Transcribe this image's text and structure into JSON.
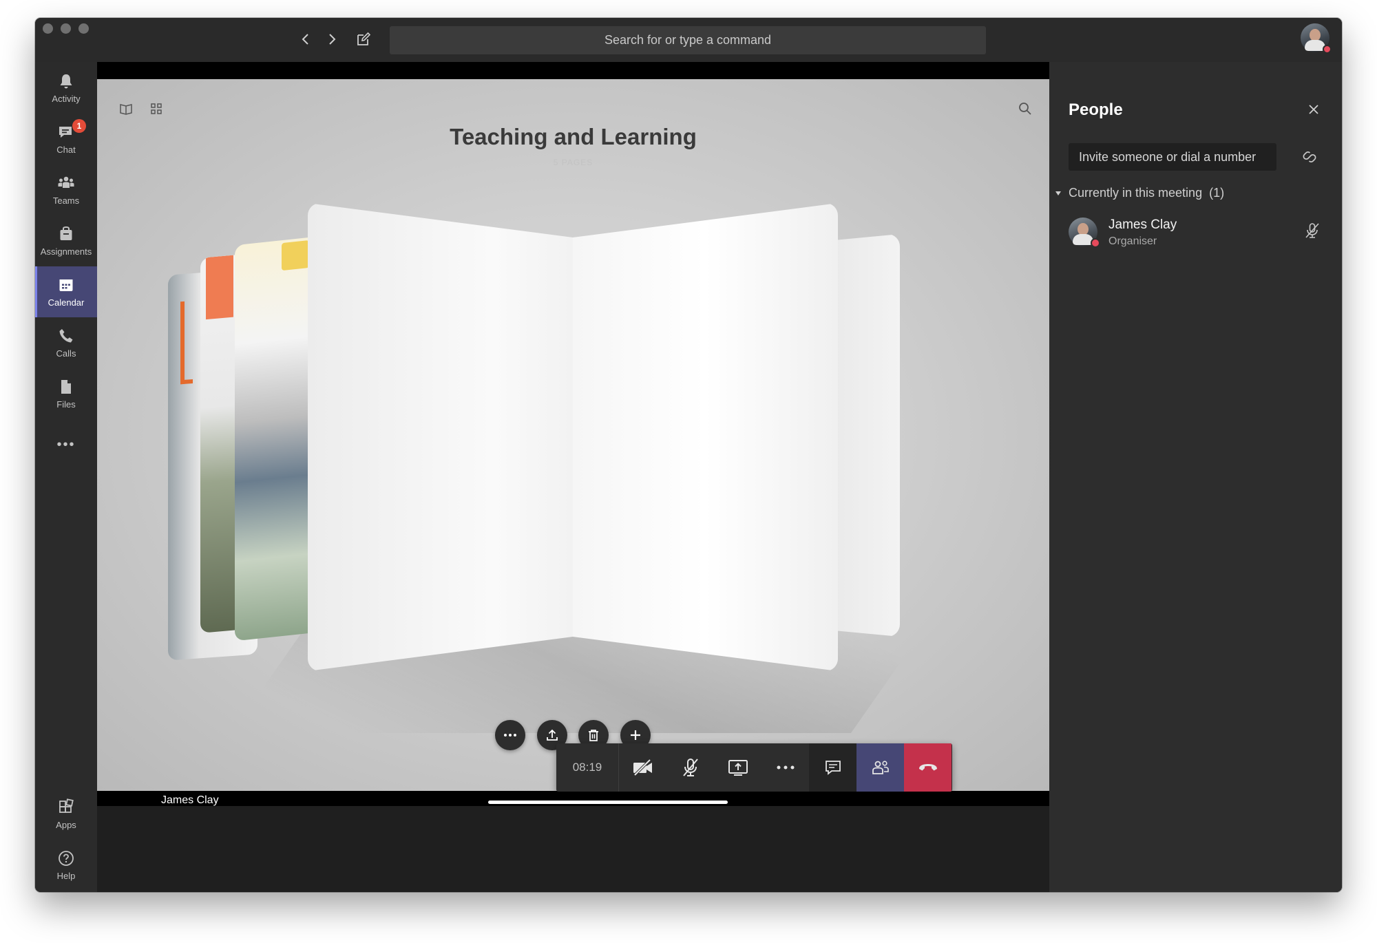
{
  "window": {
    "search_placeholder": "Search for or type a command"
  },
  "rail": {
    "items": [
      {
        "label": "Activity",
        "icon": "bell-icon"
      },
      {
        "label": "Chat",
        "icon": "chat-icon",
        "badge": "1"
      },
      {
        "label": "Teams",
        "icon": "teams-icon"
      },
      {
        "label": "Assignments",
        "icon": "assignments-icon"
      },
      {
        "label": "Calendar",
        "icon": "calendar-icon",
        "active": true
      },
      {
        "label": "Calls",
        "icon": "phone-icon"
      },
      {
        "label": "Files",
        "icon": "file-icon"
      }
    ],
    "more_label": "•••",
    "bottom": [
      {
        "label": "Apps",
        "icon": "apps-icon"
      },
      {
        "label": "Help",
        "icon": "help-icon"
      }
    ]
  },
  "share": {
    "title": "Teaching and Learning",
    "subtitle": "5 PAGES",
    "presenter": "James Clay",
    "progress": 1.0
  },
  "callbar": {
    "timer": "08:19"
  },
  "panel": {
    "title": "People",
    "invite_placeholder": "Invite someone or dial a number",
    "section_label": "Currently in this meeting",
    "section_count": "(1)",
    "participants": [
      {
        "name": "James Clay",
        "role": "Organiser"
      }
    ]
  },
  "colors": {
    "accent": "#464775",
    "hangup": "#c4314b",
    "badge": "#e44c39",
    "status": "#e64a5c"
  }
}
